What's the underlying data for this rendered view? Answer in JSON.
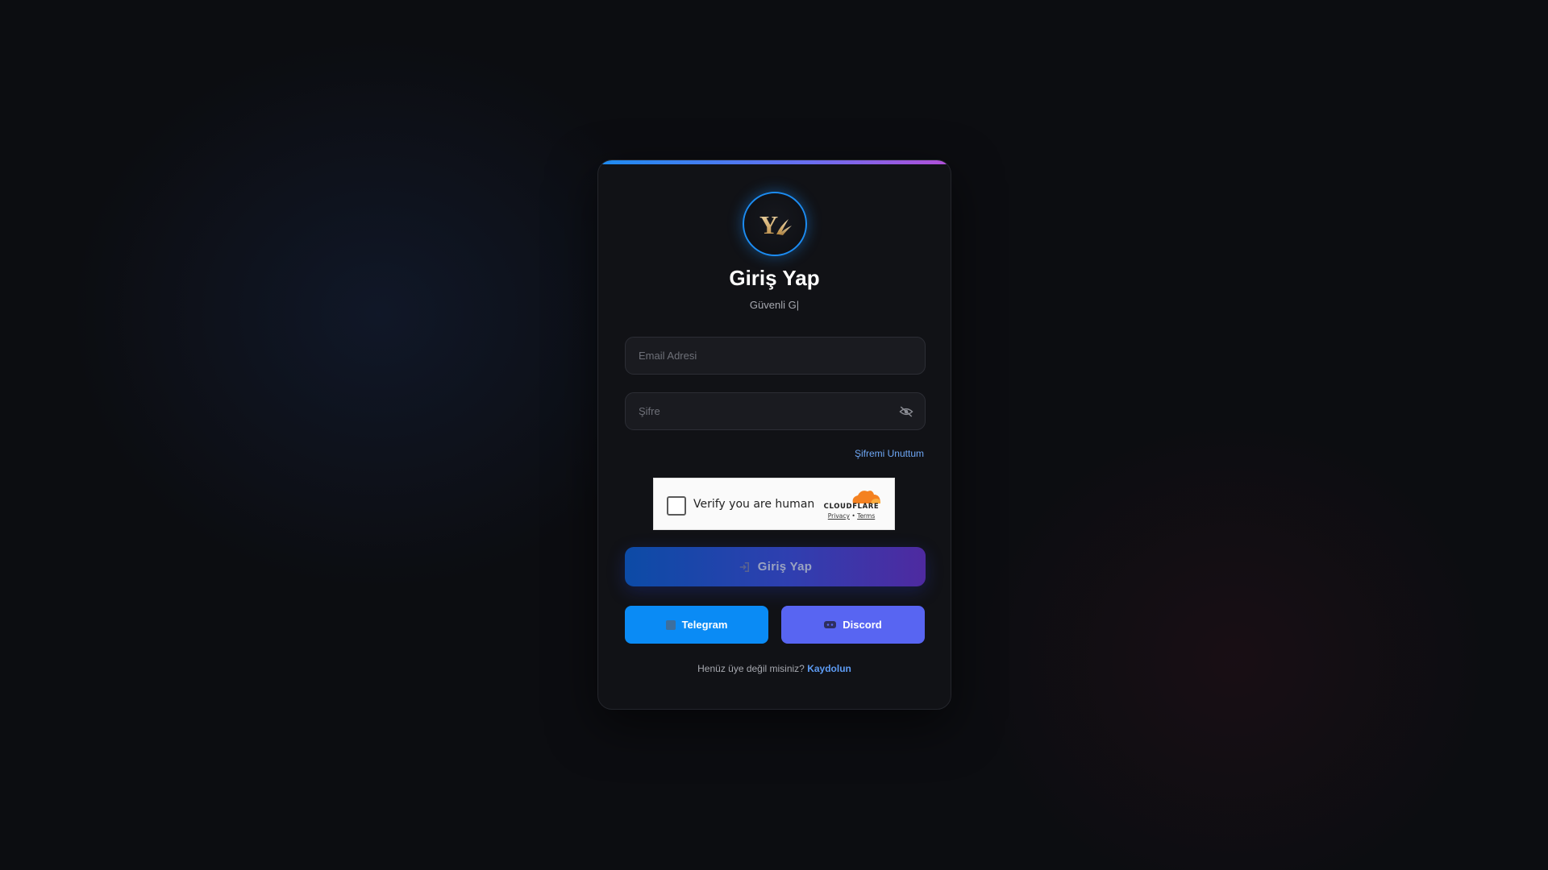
{
  "login": {
    "logo_letter": "Y",
    "title": "Giriş Yap",
    "subtitle": "Güvenli G|",
    "email": {
      "placeholder": "Email Adresi",
      "value": ""
    },
    "password": {
      "placeholder": "Şifre",
      "value": ""
    },
    "password_toggle_icon": "eye-off-icon",
    "forgot_label": "Şifremi Unuttum",
    "captcha": {
      "label": "Verify you are human",
      "brand": "CLOUDFLARE",
      "privacy": "Privacy",
      "separator": "•",
      "terms": "Terms"
    },
    "submit_label": "Giriş Yap",
    "submit_icon": "login-icon",
    "telegram_label": "Telegram",
    "telegram_icon": "telegram-icon",
    "discord_label": "Discord",
    "discord_icon": "discord-icon",
    "footer_text": "Henüz üye değil misiniz?",
    "footer_link": "Kaydolun"
  },
  "colors": {
    "accent_blue": "#1c8cf2",
    "accent_purple": "#b24fd8",
    "telegram": "#0a8bf5",
    "discord": "#5865f2",
    "link": "#6ea7f5",
    "card_bg": "#111216",
    "page_bg": "#0c0d11"
  }
}
